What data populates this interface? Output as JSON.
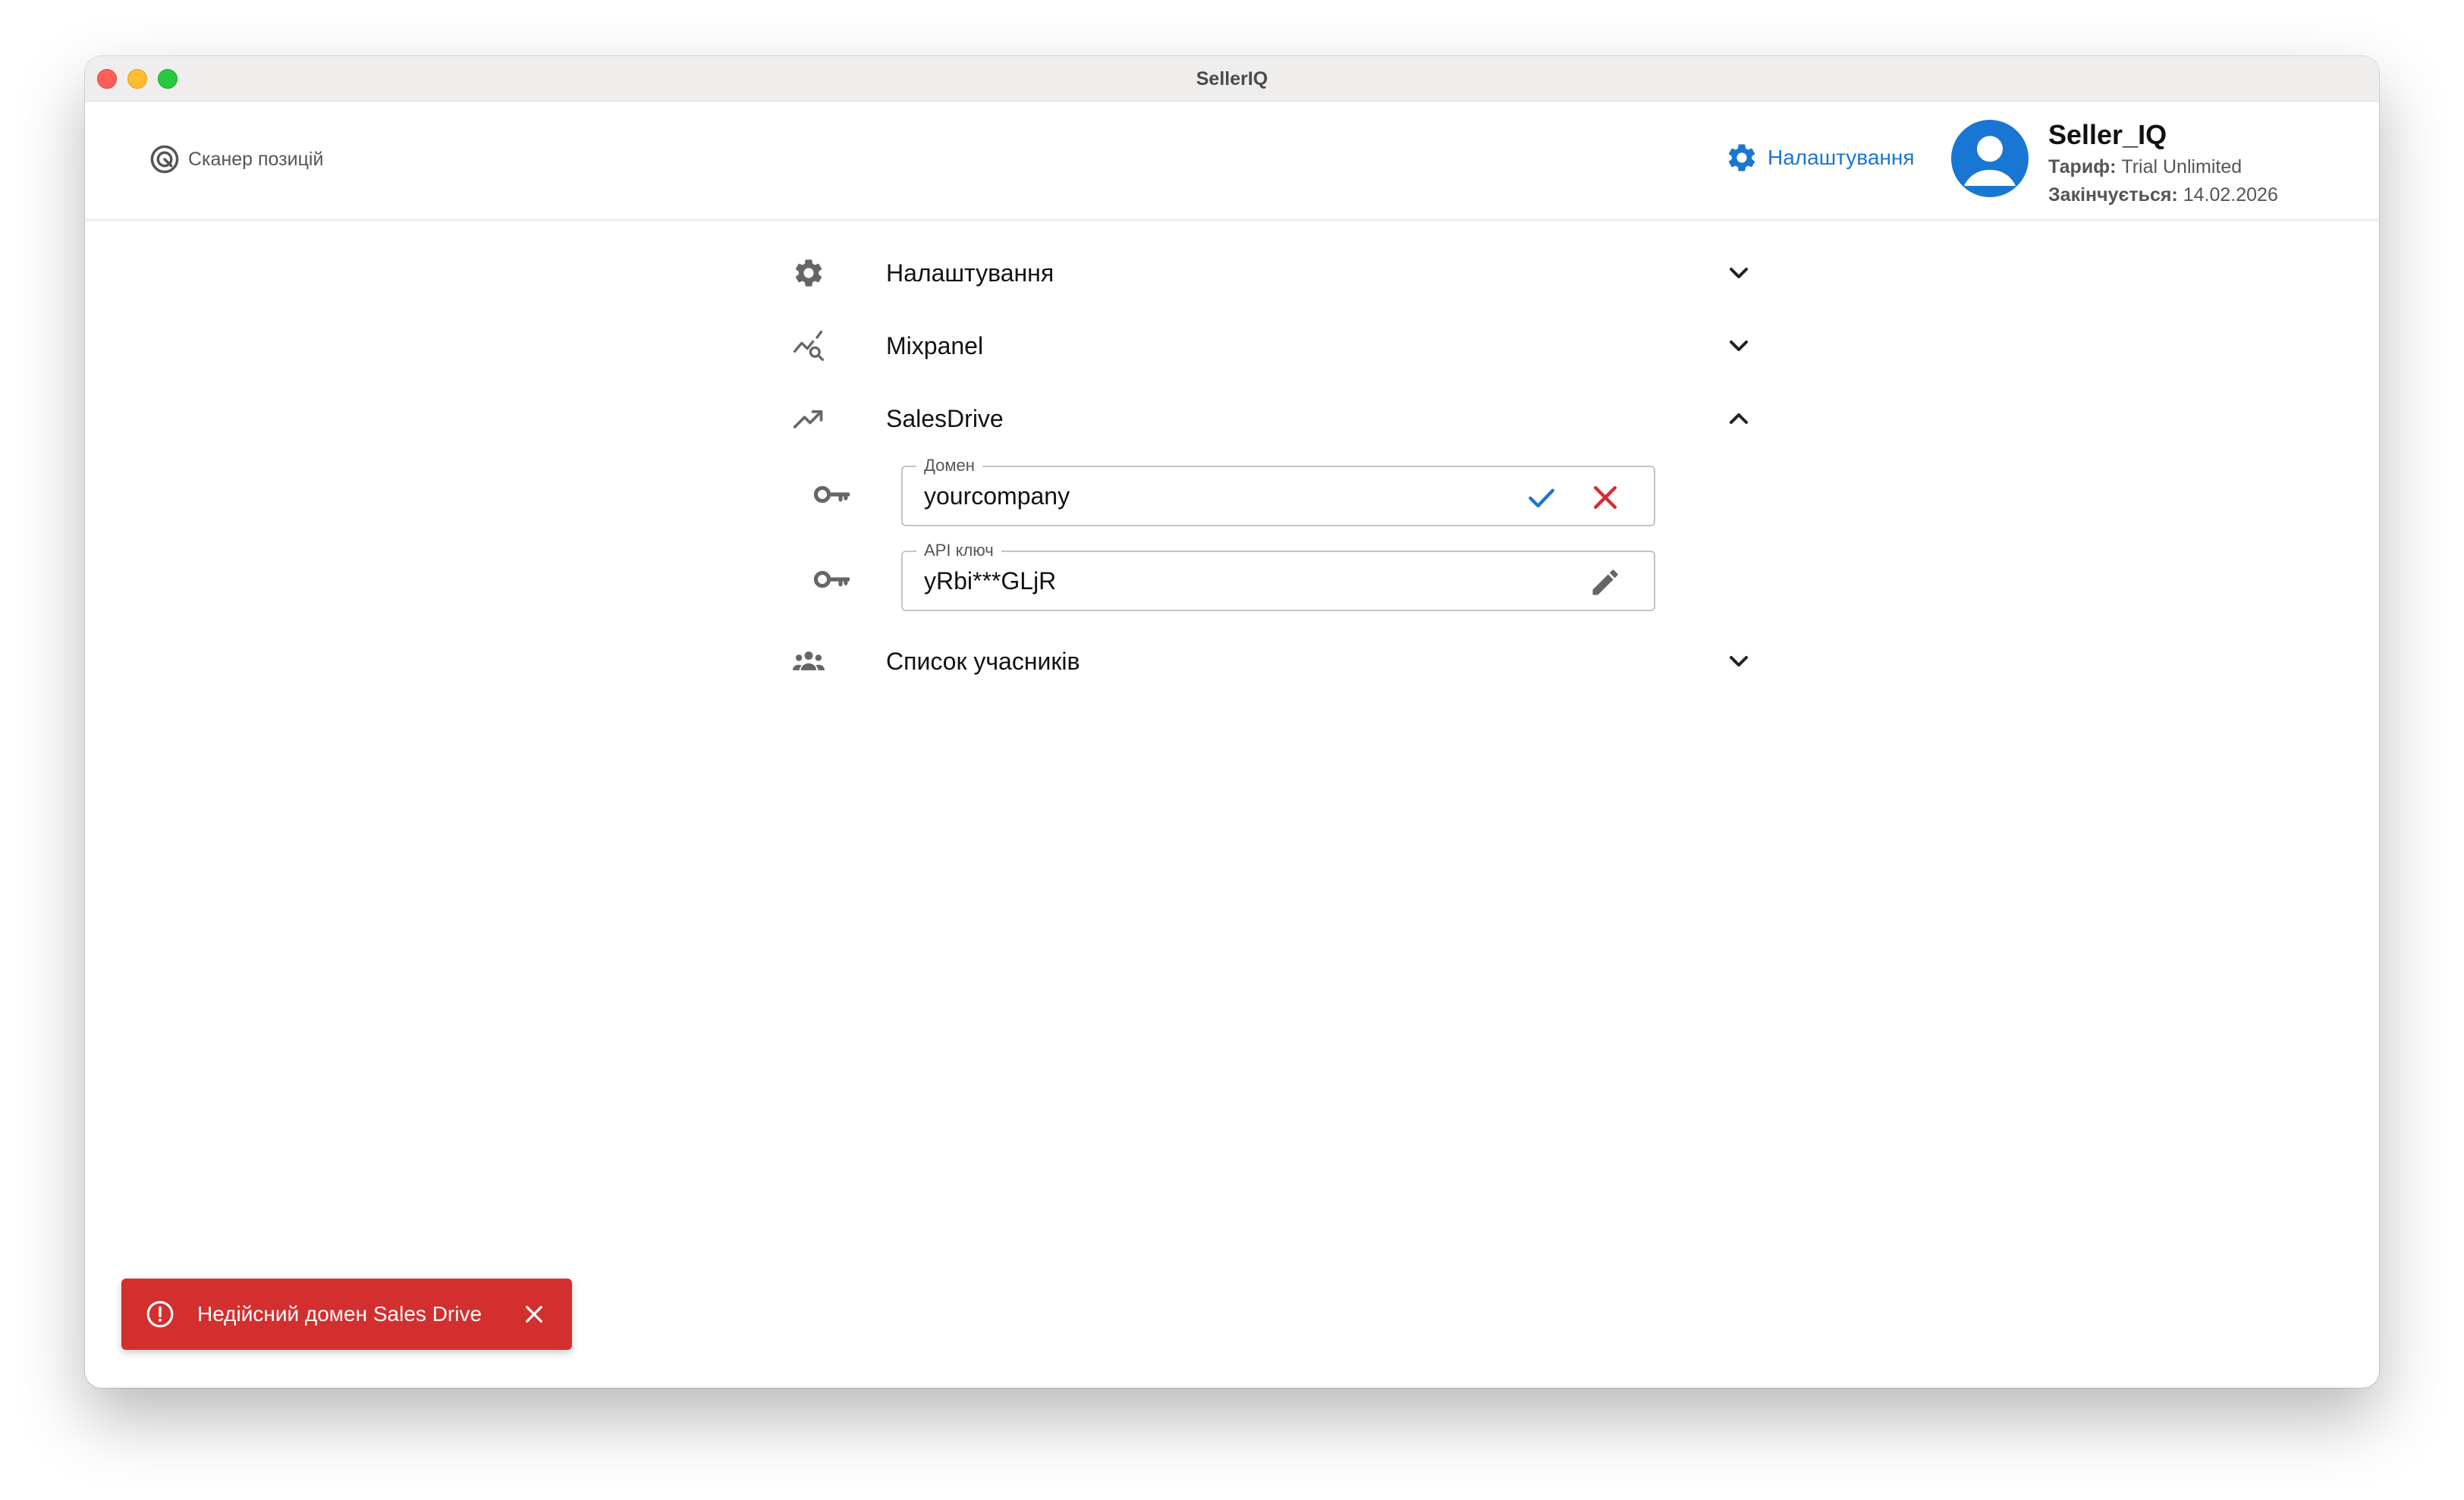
{
  "window": {
    "title": "SellerIQ"
  },
  "header": {
    "scanner_label": "Сканер позицій",
    "settings_label": "Налаштування",
    "user": {
      "name": "Seller_IQ",
      "plan_label": "Тариф:",
      "plan_value": "Trial Unlimited",
      "expires_label": "Закінчується:",
      "expires_value": "14.02.2026"
    }
  },
  "sections": {
    "settings": {
      "label": "Налаштування",
      "icon": "gear-icon",
      "expanded": false
    },
    "mixpanel": {
      "label": "Mixpanel",
      "icon": "analytics-icon",
      "expanded": false
    },
    "salesdrive": {
      "label": "SalesDrive",
      "icon": "trending-up-icon",
      "expanded": true,
      "domain_field": {
        "label": "Домен",
        "value": "yourcompany"
      },
      "api_key_field": {
        "label": "API ключ",
        "value": "yRbi***GLjR"
      }
    },
    "members": {
      "label": "Список учасників",
      "icon": "group-icon",
      "expanded": false
    }
  },
  "toast": {
    "message": "Недійсний домен Sales Drive",
    "color": "#d32f2f"
  },
  "colors": {
    "accent": "#1976d2",
    "error": "#d32f2f"
  }
}
